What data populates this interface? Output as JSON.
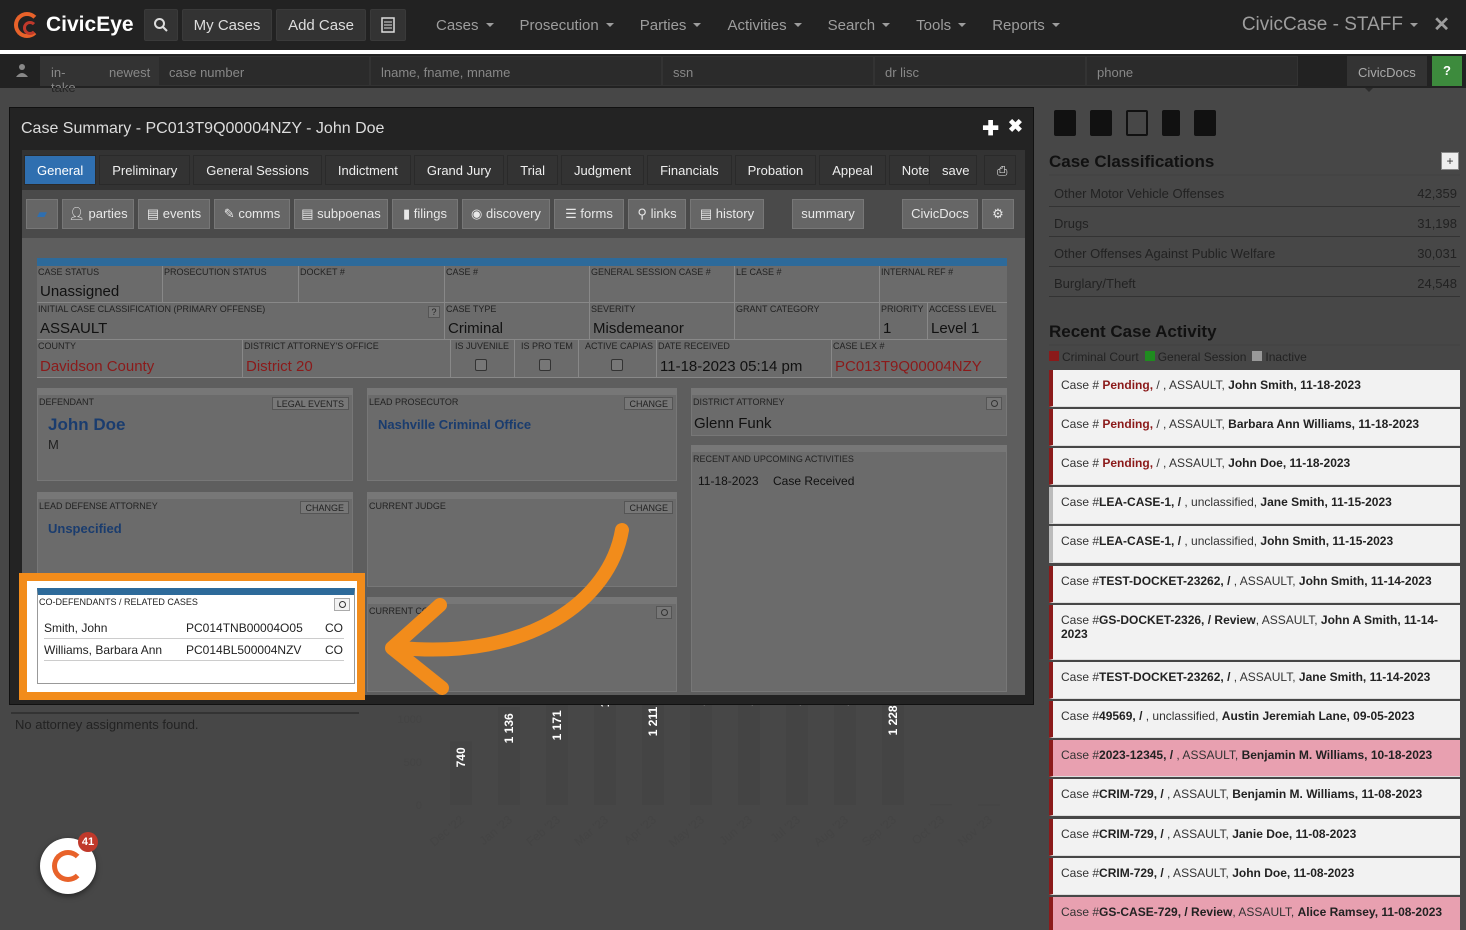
{
  "topnav": {
    "brand": "CivicEye",
    "my_cases": "My Cases",
    "add_case": "Add Case",
    "menus": [
      "Cases",
      "Prosecution",
      "Parties",
      "Activities",
      "Search",
      "Tools",
      "Reports"
    ],
    "app_title": "CivicCase - STAFF",
    "close": "✕"
  },
  "subbar": {
    "intake": "in-take",
    "newest": "newest",
    "case_number_placeholder": "case number",
    "name_placeholder": "lname, fname, mname",
    "ssn_placeholder": "ssn",
    "drlisc_placeholder": "dr lisc",
    "phone_placeholder": "phone",
    "civicdocs": "CivicDocs",
    "help": "?"
  },
  "modal": {
    "title": "Case Summary - PC013T9Q00004NZY - John Doe",
    "tabs": [
      "General",
      "Preliminary",
      "General Sessions",
      "Indictment",
      "Grand Jury",
      "Trial",
      "Judgment",
      "Financials",
      "Probation",
      "Appeal",
      "Notes (0)"
    ],
    "save": "save",
    "tools": [
      "parties",
      "events",
      "comms",
      "subpoenas",
      "filings",
      "discovery",
      "forms",
      "links",
      "history"
    ],
    "summary": "summary",
    "civicdocs": "CivicDocs"
  },
  "case": {
    "labels": {
      "case_status": "CASE STATUS",
      "prosecution_status": "PROSECUTION STATUS",
      "docket": "DOCKET #",
      "case_num": "CASE #",
      "gs_case": "GENERAL SESSION CASE #",
      "le_case": "LE CASE #",
      "internal_ref": "INTERNAL REF #",
      "initial_class": "INITIAL CASE CLASSIFICATION (PRIMARY OFFENSE)",
      "case_type": "CASE TYPE",
      "severity": "SEVERITY",
      "grant_category": "GRANT CATEGORY",
      "priority": "PRIORITY",
      "access_level": "ACCESS LEVEL",
      "county": "COUNTY",
      "da_office": "DISTRICT ATTORNEY'S OFFICE",
      "is_juvenile": "IS JUVENILE",
      "is_pro_tem": "IS PRO TEM",
      "active_capias": "ACTIVE CAPIAS",
      "date_received": "DATE RECEIVED",
      "case_lex": "CASE LEX #"
    },
    "case_status": "Unassigned",
    "initial_class": "ASSAULT",
    "case_type": "Criminal",
    "severity": "Misdemeanor",
    "priority": "1",
    "access_level": "Level 1",
    "county": "Davidson County",
    "da_office": "District 20",
    "date_received": "11-18-2023 05:14 pm",
    "case_lex": "PC013T9Q00004NZY",
    "qm": "?"
  },
  "panels": {
    "defendant_label": "DEFENDANT",
    "legal_events": "LEGAL EVENTS",
    "defendant_name": "John Doe",
    "defendant_sex": "M",
    "lead_prosecutor_label": "LEAD PROSECUTOR",
    "change": "CHANGE",
    "lead_prosecutor": "Nashville Criminal Office",
    "da_label": "DISTRICT ATTORNEY",
    "da_name": "Glenn Funk",
    "recent_label": "RECENT AND UPCOMING ACTIVITIES",
    "recent_date": "11-18-2023",
    "recent_text": "Case Received",
    "defense_label": "LEAD DEFENSE ATTORNEY",
    "defense_value": "Unspecified",
    "judge_label": "CURRENT JUDGE",
    "current_label": "CURRENT CO",
    "codef_label": "CO-DEFENDANTS / RELATED CASES",
    "codefendants": [
      {
        "name": "Smith, John",
        "case": "PC014TNB00004O05",
        "role": "CO"
      },
      {
        "name": "Williams, Barbara Ann",
        "case": "PC014BL500004NZV",
        "role": "CO"
      }
    ]
  },
  "background": {
    "no_attorney": "No attorney assignments found."
  },
  "right": {
    "classifications_title": "Case Classifications",
    "plus": "+",
    "classifications": [
      {
        "name": "Other Motor Vehicle Offenses",
        "count": "42,359"
      },
      {
        "name": "Drugs",
        "count": "31,198"
      },
      {
        "name": "Other Offenses Against Public Welfare",
        "count": "30,031"
      },
      {
        "name": "Burglary/Theft",
        "count": "24,548"
      }
    ],
    "recent_title": "Recent Case Activity",
    "legend": [
      {
        "label": "Criminal Court",
        "color": "#8b1a1a"
      },
      {
        "label": "General Session",
        "color": "#1f8b1f"
      },
      {
        "label": "Inactive",
        "color": "#999999"
      }
    ],
    "activity": [
      {
        "pre": "Case # ",
        "id": "Pending,",
        "mid": " / , ASSAULT, ",
        "who": "John Smith, 11-18-2023",
        "style": "pending"
      },
      {
        "pre": "Case # ",
        "id": "Pending,",
        "mid": " / , ASSAULT, ",
        "who": "Barbara Ann Williams, 11-18-2023",
        "style": "pending"
      },
      {
        "pre": "Case # ",
        "id": "Pending,",
        "mid": " / , ASSAULT, ",
        "who": "John Doe, 11-18-2023",
        "style": "pending"
      },
      {
        "pre": "Case #",
        "id": "LEA-CASE-1, /",
        "mid": " , unclassified, ",
        "who": "Jane Smith, 11-15-2023",
        "style": "gray"
      },
      {
        "pre": "Case #",
        "id": "LEA-CASE-1, /",
        "mid": " , unclassified, ",
        "who": "John Smith, 11-15-2023",
        "style": "gray"
      },
      {
        "pre": "Case #",
        "id": "TEST-DOCKET-23262, /",
        "mid": " , ASSAULT, ",
        "who": "John Smith, 11-14-2023",
        "style": "red"
      },
      {
        "pre": "Case #",
        "id": "GS-DOCKET-2326, / Review",
        "mid": ", ASSAULT, ",
        "who": "John A Smith, 11-14-2023",
        "style": "red"
      },
      {
        "pre": "Case #",
        "id": "TEST-DOCKET-23262, /",
        "mid": " , ASSAULT, ",
        "who": "Jane Smith, 11-14-2023",
        "style": "red"
      },
      {
        "pre": "Case #",
        "id": "49569, /",
        "mid": " , unclassified, ",
        "who": "Austin Jeremiah Lane, 09-05-2023",
        "style": "red"
      },
      {
        "pre": "Case #",
        "id": "2023-12345, /",
        "mid": " , ASSAULT, ",
        "who": "Benjamin M. Williams, 10-18-2023",
        "style": "pink"
      },
      {
        "pre": "Case #",
        "id": "CRIM-729, /",
        "mid": " , ASSAULT, ",
        "who": "Benjamin M. Williams, 11-08-2023",
        "style": "red"
      },
      {
        "pre": "Case #",
        "id": "CRIM-729, /",
        "mid": " , ASSAULT, ",
        "who": "Janie Doe, 11-08-2023",
        "style": "red"
      },
      {
        "pre": "Case #",
        "id": "CRIM-729, /",
        "mid": " , ASSAULT, ",
        "who": "John Doe, 11-08-2023",
        "style": "red"
      },
      {
        "pre": "Case #",
        "id": "GS-CASE-729, / Review",
        "mid": ", ASSAULT, ",
        "who": "Alice Ramsey, 11-08-2023",
        "style": "pink"
      }
    ],
    "fab_badge": "41"
  },
  "chart_data": {
    "type": "bar",
    "categories": [
      "Dec '22",
      "Jan '23",
      "Feb '23",
      "Mar '23",
      "Apr '23",
      "May '23",
      "Jun '23",
      "Jul '23",
      "Aug '23",
      "Sep '23",
      "Oct '23",
      "Nov '23"
    ],
    "values": [
      740,
      1136,
      1171,
      1400,
      1211,
      1300,
      1300,
      1300,
      1300,
      1228,
      10,
      5
    ],
    "data_labels": [
      "740",
      "1 136",
      "1 171",
      "1 4",
      "1 211",
      "1",
      "1",
      "1",
      "1",
      "1 228",
      "",
      ""
    ],
    "yticks": [
      "0",
      "500",
      "1000"
    ],
    "ylim": [
      0,
      1500
    ],
    "bar_color": "#444444"
  }
}
